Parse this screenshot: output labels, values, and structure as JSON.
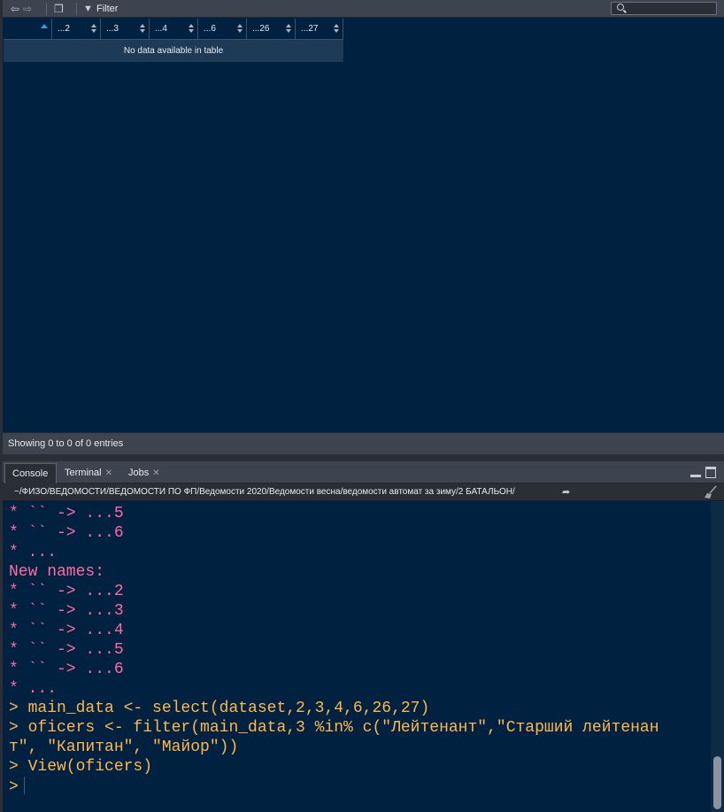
{
  "viewer": {
    "filter_label": "Filter",
    "search": {
      "value": ""
    },
    "columns": [
      "",
      "...2",
      "...3",
      "...4",
      "...6",
      "...26",
      "...27"
    ],
    "empty_message": "No data available in table",
    "status": "Showing 0 to 0 of 0 entries"
  },
  "console": {
    "tabs": [
      {
        "label": "Console",
        "closable": false,
        "active": true
      },
      {
        "label": "Terminal",
        "closable": true,
        "active": false
      },
      {
        "label": "Jobs",
        "closable": true,
        "active": false
      }
    ],
    "path": "~/ФИЗО/ВЕДОМОСТИ/ВЕДОМОСТИ ПО ФП/Ведомости 2020/Ведомости весна/ведомости автомат за зиму/2 БАТАЛЬОН/",
    "lines": [
      {
        "kind": "msg",
        "text": "* `` -> ...5"
      },
      {
        "kind": "msg",
        "text": "* `` -> ...6"
      },
      {
        "kind": "msg",
        "text": "* ..."
      },
      {
        "kind": "msg",
        "text": "New names:"
      },
      {
        "kind": "msg",
        "text": "* `` -> ...2"
      },
      {
        "kind": "msg",
        "text": "* `` -> ...3"
      },
      {
        "kind": "msg",
        "text": "* `` -> ...4"
      },
      {
        "kind": "msg",
        "text": "* `` -> ...5"
      },
      {
        "kind": "msg",
        "text": "* `` -> ...6"
      },
      {
        "kind": "msg",
        "text": "* ..."
      },
      {
        "kind": "cmd",
        "text": "> main_data <- select(dataset,2,3,4,6,26,27)"
      },
      {
        "kind": "cmd",
        "text": "> oficers <- filter(main_data,3 %in% c(\"Лейтенант\",\"Старший лейтенан"
      },
      {
        "kind": "cmd",
        "text": "т\", \"Капитан\", \"Майор\"))"
      },
      {
        "kind": "cmd",
        "text": "> View(oficers)"
      }
    ],
    "prompt": ">",
    "colors": {
      "message": "#ff6aa0",
      "command": "#ffb74d",
      "background": "#002240"
    }
  },
  "icons": {
    "back": "arrow-left-icon",
    "forward": "arrow-right-icon",
    "popout": "popout-icon",
    "filter": "funnel-icon",
    "search": "search-icon",
    "minimize": "minimize-icon",
    "maximize": "maximize-icon",
    "goto_dir": "goto-directory-icon",
    "clear": "broom-icon"
  }
}
